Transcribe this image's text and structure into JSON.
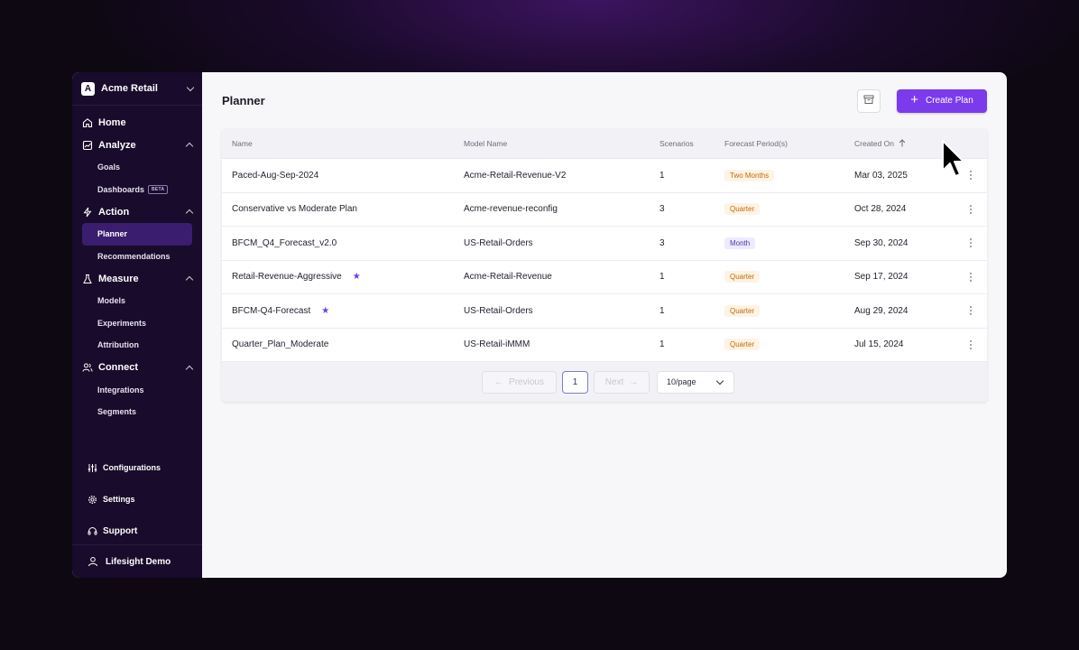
{
  "org": {
    "initial": "A",
    "name": "Acme Retail"
  },
  "nav": {
    "home": "Home",
    "analyze": {
      "label": "Analyze",
      "items": [
        "Goals",
        "Dashboards"
      ],
      "beta": "BETA"
    },
    "action": {
      "label": "Action",
      "items": [
        "Planner",
        "Recommendations"
      ]
    },
    "measure": {
      "label": "Measure",
      "items": [
        "Models",
        "Experiments",
        "Attribution"
      ]
    },
    "connect": {
      "label": "Connect",
      "items": [
        "Integrations",
        "Segments"
      ]
    },
    "configurations": "Configurations",
    "settings": "Settings",
    "support": "Support",
    "user": "Lifesight Demo"
  },
  "page": {
    "title": "Planner",
    "create_label": "Create Plan"
  },
  "table": {
    "columns": [
      "Name",
      "Model Name",
      "Scenarios",
      "Forecast Period(s)",
      "Created On"
    ],
    "sort_icon": "arrow-up-icon",
    "rows": [
      {
        "name": "Paced-Aug-Sep-2024",
        "model": "Acme-Retail-Revenue-V2",
        "scenarios": "1",
        "period": "Two Months",
        "created": "Mar 03, 2025",
        "starred": false
      },
      {
        "name": "Conservative vs Moderate Plan",
        "model": "Acme-revenue-reconfig",
        "scenarios": "3",
        "period": "Quarter",
        "created": "Oct 28, 2024",
        "starred": false
      },
      {
        "name": "BFCM_Q4_Forecast_v2.0",
        "model": "US-Retail-Orders",
        "scenarios": "3",
        "period": "Month",
        "created": "Sep 30, 2024",
        "starred": false
      },
      {
        "name": "Retail-Revenue-Aggressive",
        "model": "Acme-Retail-Revenue",
        "scenarios": "1",
        "period": "Quarter",
        "created": "Sep 17, 2024",
        "starred": true
      },
      {
        "name": "BFCM-Q4-Forecast",
        "model": "US-Retail-Orders",
        "scenarios": "1",
        "period": "Quarter",
        "created": "Aug 29, 2024",
        "starred": true
      },
      {
        "name": "Quarter_Plan_Moderate",
        "model": "US-Retail-iMMM",
        "scenarios": "1",
        "period": "Quarter",
        "created": "Jul 15, 2024",
        "starred": false
      }
    ]
  },
  "pagination": {
    "previous": "Previous",
    "page": "1",
    "next": "Next",
    "page_size": "10/page"
  },
  "colors": {
    "accent": "#7c3aed",
    "sidebar": "#180b2b",
    "badge_orange": "#c36a05",
    "badge_purple": "#4a3aa8"
  }
}
